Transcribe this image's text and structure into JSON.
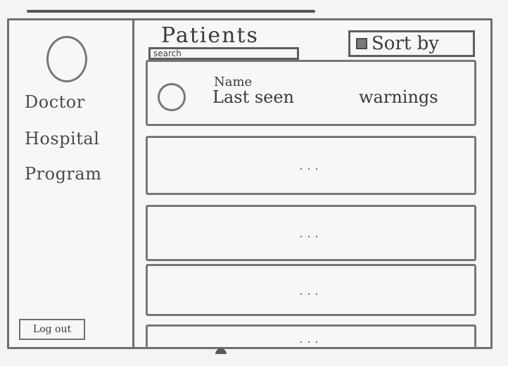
{
  "sidebar": {
    "line1": "Doctor",
    "line2": "Hospital",
    "line3": "Program",
    "logout_label": "Log out"
  },
  "main": {
    "title": "Patients",
    "search_placeholder": "search",
    "sort_label": "Sort by",
    "first_card": {
      "name_label": "Name",
      "last_seen_label": "Last seen",
      "warnings_label": "warnings"
    },
    "placeholder_cards": [
      {
        "text": "..."
      },
      {
        "text": "..."
      },
      {
        "text": "..."
      },
      {
        "text": "..."
      }
    ]
  },
  "colors": {
    "stroke": "#6f6f6f",
    "paper": "#f4f4f2"
  }
}
